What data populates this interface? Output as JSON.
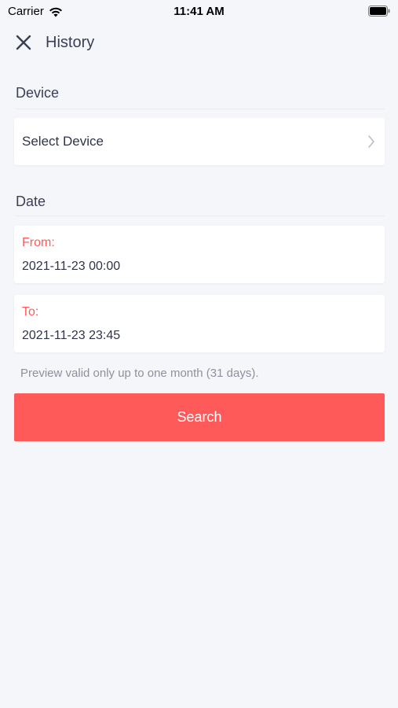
{
  "status_bar": {
    "carrier": "Carrier",
    "time": "11:41 AM"
  },
  "nav": {
    "title": "History",
    "close_icon": "close-icon"
  },
  "device_section": {
    "title": "Device",
    "select_label": "Select Device",
    "chevron_icon": "chevron-right-icon"
  },
  "date_section": {
    "title": "Date",
    "from_label": "From:",
    "from_value": "2021-11-23 00:00",
    "to_label": "To:",
    "to_value": "2021-11-23 23:45",
    "hint": "Preview valid only up to one month (31 days)."
  },
  "search_button": {
    "label": "Search"
  },
  "colors": {
    "accent": "#ff5a5a",
    "background": "#f5f6f9",
    "text": "#2f3447",
    "hint": "#8e919b"
  }
}
